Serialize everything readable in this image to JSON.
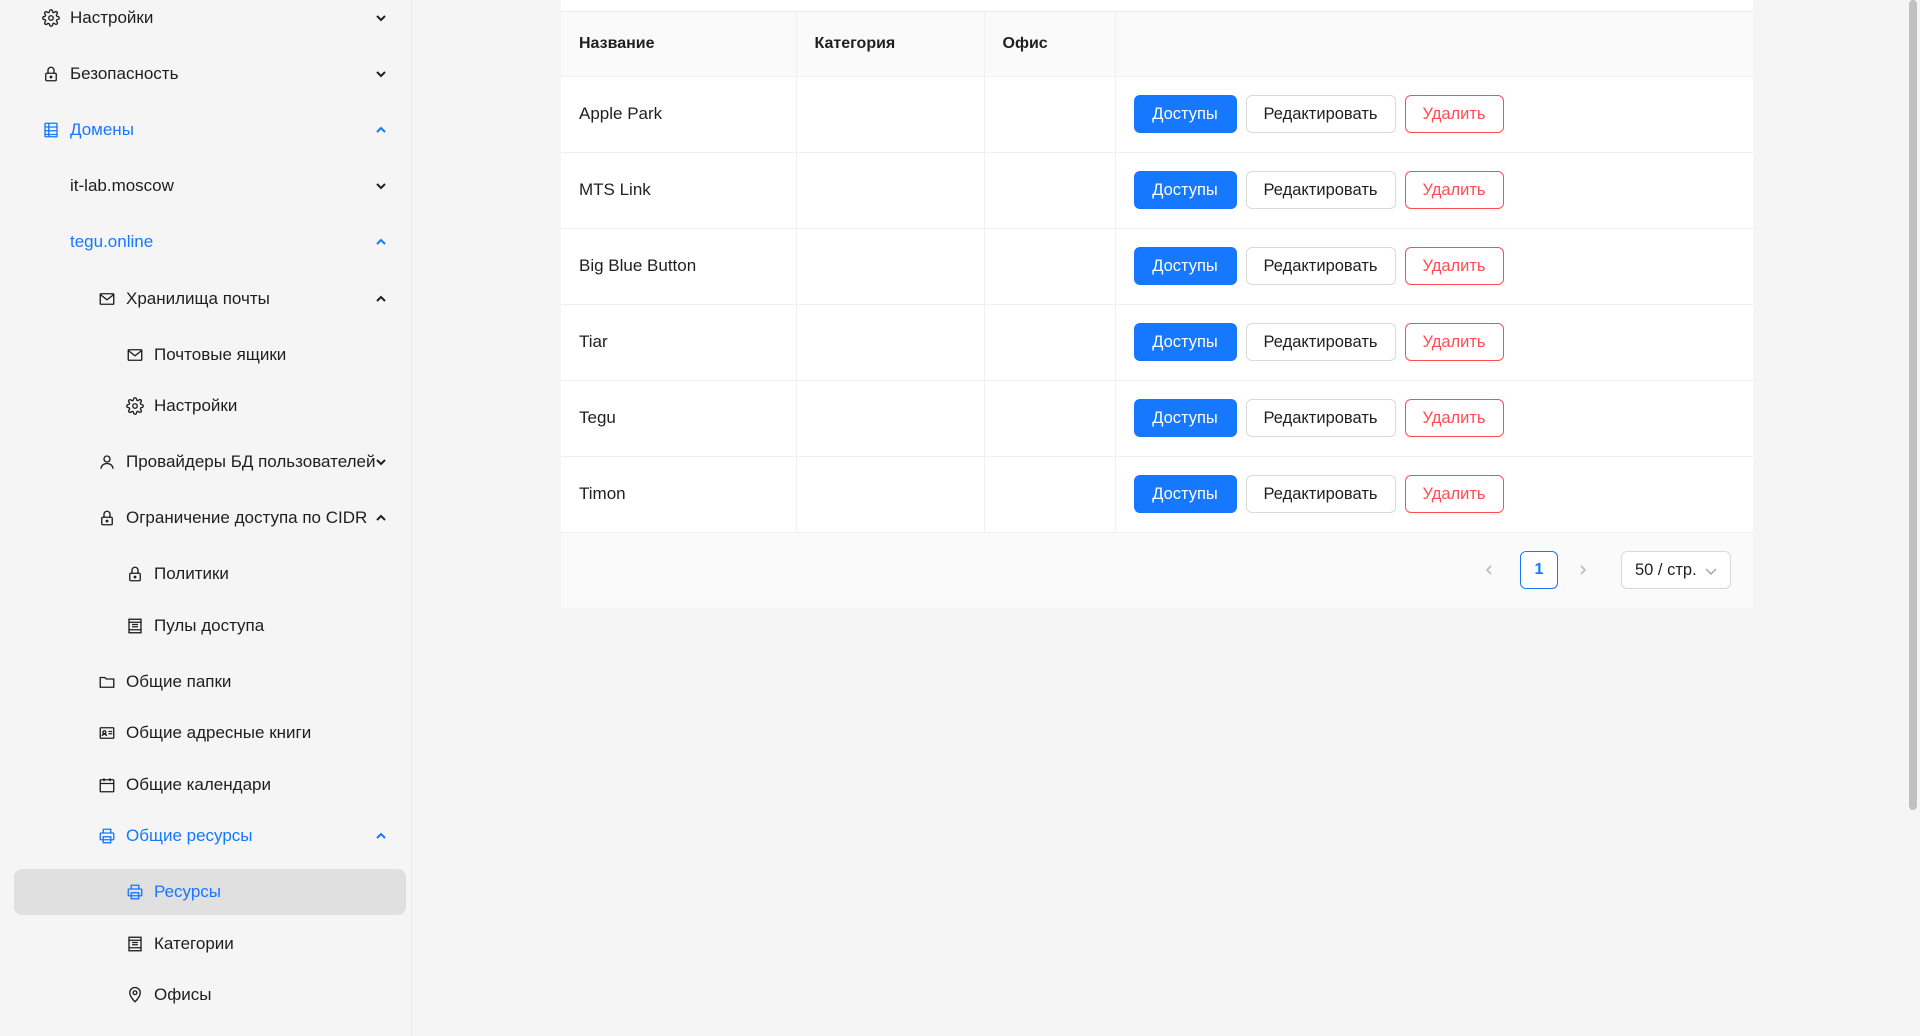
{
  "sidebar": {
    "items": [
      {
        "label": "Настройки",
        "icon": "gear-icon",
        "expanded": false
      },
      {
        "label": "Безопасность",
        "icon": "lock-icon",
        "expanded": false
      },
      {
        "label": "Домены",
        "icon": "domain-icon",
        "expanded": true,
        "active": true
      },
      {
        "label": "it-lab.moscow",
        "expanded": false
      },
      {
        "label": "tegu.online",
        "expanded": true,
        "active": true
      },
      {
        "label": "Хранилища почты",
        "icon": "mail-icon",
        "expanded": true
      },
      {
        "label": "Почтовые ящики",
        "icon": "mail-icon"
      },
      {
        "label": "Настройки",
        "icon": "gear-icon"
      },
      {
        "label": "Провайдеры БД пользователей",
        "icon": "user-icon",
        "expanded": false
      },
      {
        "label": "Ограничение доступа по CIDR",
        "icon": "lock-icon",
        "expanded": true
      },
      {
        "label": "Политики",
        "icon": "lock-icon"
      },
      {
        "label": "Пулы доступа",
        "icon": "pool-icon"
      },
      {
        "label": "Общие папки",
        "icon": "folder-icon"
      },
      {
        "label": "Общие адресные книги",
        "icon": "contact-card-icon"
      },
      {
        "label": "Общие календари",
        "icon": "calendar-icon"
      },
      {
        "label": "Общие ресурсы",
        "icon": "printer-icon",
        "expanded": true,
        "active": true
      },
      {
        "label": "Ресурсы",
        "icon": "printer-icon",
        "selected": true
      },
      {
        "label": "Категории",
        "icon": "pool-icon"
      },
      {
        "label": "Офисы",
        "icon": "location-pin-icon"
      }
    ]
  },
  "table": {
    "headers": {
      "name": "Название",
      "category": "Категория",
      "office": "Офис"
    },
    "rows": [
      {
        "name": "Apple Park",
        "category": "",
        "office": ""
      },
      {
        "name": "MTS Link",
        "category": "",
        "office": ""
      },
      {
        "name": "Big Blue Button",
        "category": "",
        "office": ""
      },
      {
        "name": "Tiar",
        "category": "",
        "office": ""
      },
      {
        "name": "Tegu",
        "category": "",
        "office": ""
      },
      {
        "name": "Timon",
        "category": "",
        "office": ""
      }
    ],
    "actions": {
      "access": "Доступы",
      "edit": "Редактировать",
      "delete": "Удалить"
    }
  },
  "pagination": {
    "current_page": "1",
    "page_size": "50 / стр."
  },
  "colors": {
    "primary": "#1677ff",
    "danger": "#ff4d4f",
    "selected_bg": "#e0e0e0"
  }
}
